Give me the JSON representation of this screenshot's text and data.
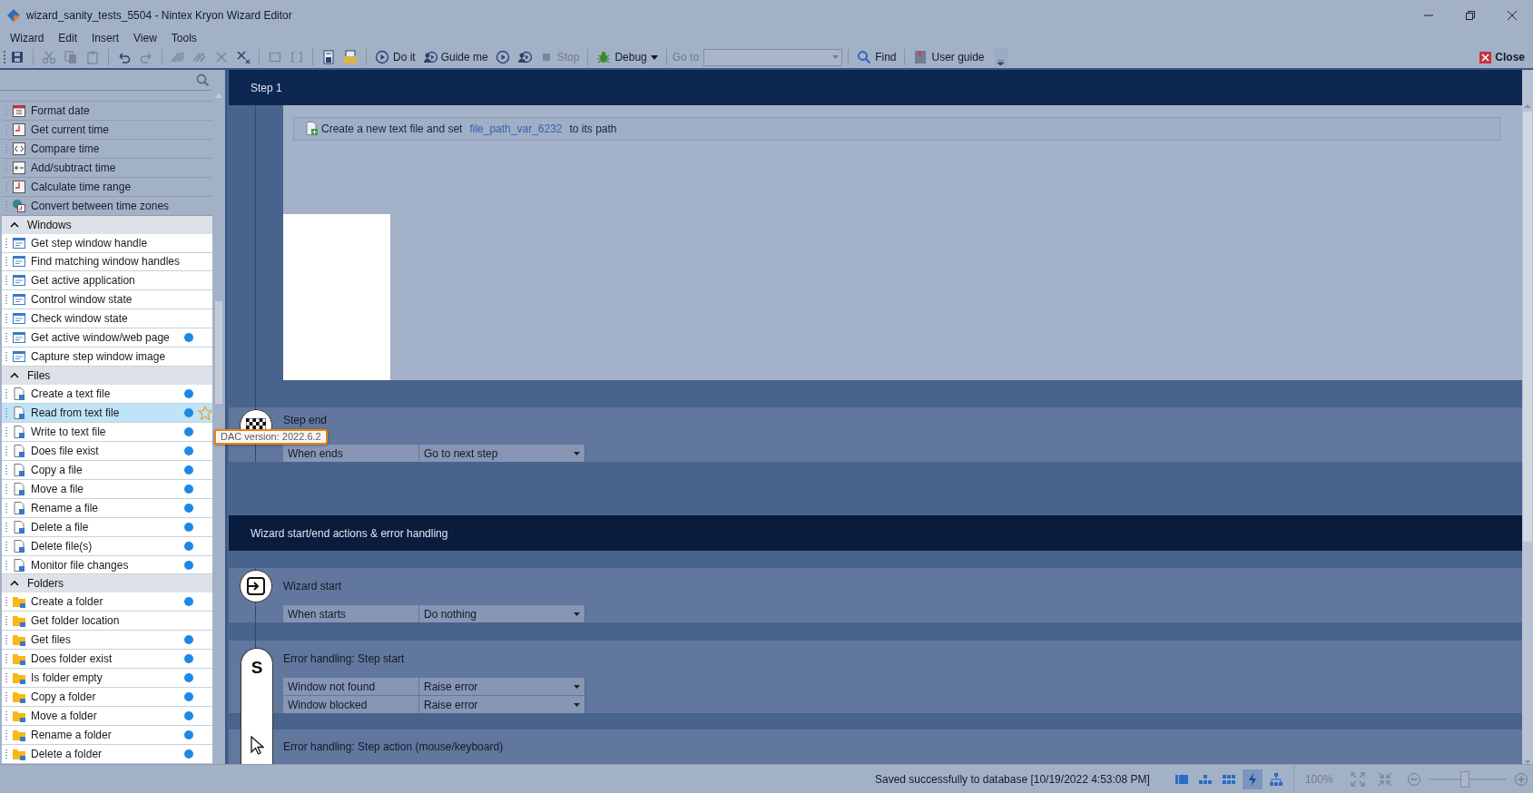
{
  "window": {
    "title": "wizard_sanity_tests_5504 - Nintex Kryon Wizard Editor"
  },
  "menu": [
    "Wizard",
    "Edit",
    "Insert",
    "View",
    "Tools"
  ],
  "toolbar": [
    {
      "kind": "save",
      "disabled": false
    },
    {
      "kind": "sep"
    },
    {
      "kind": "cut",
      "disabled": true
    },
    {
      "kind": "copy",
      "disabled": true
    },
    {
      "kind": "paste",
      "disabled": true
    },
    {
      "kind": "sep"
    },
    {
      "kind": "undo",
      "disabled": false
    },
    {
      "kind": "redo",
      "disabled": true
    },
    {
      "kind": "sep"
    },
    {
      "kind": "hatch",
      "disabled": true
    },
    {
      "kind": "hatchx",
      "disabled": true
    },
    {
      "kind": "cross",
      "disabled": true
    },
    {
      "kind": "crosssub",
      "disabled": false
    },
    {
      "kind": "sep"
    },
    {
      "kind": "square",
      "disabled": true
    },
    {
      "kind": "brackets",
      "disabled": true
    },
    {
      "kind": "sep"
    },
    {
      "kind": "docsave",
      "disabled": false
    },
    {
      "kind": "foldersave",
      "disabled": false
    },
    {
      "kind": "sep"
    },
    {
      "kind": "play",
      "label": "Do it",
      "disabled": false
    },
    {
      "kind": "guide",
      "label": "Guide me",
      "disabled": false
    },
    {
      "kind": "play",
      "disabled": false
    },
    {
      "kind": "guide",
      "disabled": false
    },
    {
      "kind": "stop",
      "label": "Stop",
      "disabled": true
    },
    {
      "kind": "sep"
    },
    {
      "kind": "debug",
      "label": "Debug",
      "disabled": false
    },
    {
      "kind": "sep"
    },
    {
      "kind": "goto",
      "label": "Go to"
    },
    {
      "kind": "sep"
    },
    {
      "kind": "find",
      "label": "Find",
      "disabled": false
    },
    {
      "kind": "sep"
    },
    {
      "kind": "book",
      "label": "User guide",
      "disabled": false
    },
    {
      "kind": "overflow"
    }
  ],
  "close_label": "Close",
  "panel": {
    "groups": [
      {
        "dimmed": true,
        "items": [
          {
            "kind": "date",
            "label": "Format date",
            "dot": false,
            "favorite": false,
            "selected": false
          },
          {
            "kind": "time",
            "label": "Get current time",
            "dot": false,
            "favorite": false,
            "selected": false
          },
          {
            "kind": "compare",
            "label": "Compare time",
            "dot": false,
            "favorite": false,
            "selected": false
          },
          {
            "kind": "plusminus",
            "label": "Add/subtract time",
            "dot": false,
            "favorite": false,
            "selected": false
          },
          {
            "kind": "time",
            "label": "Calculate time range",
            "dot": false,
            "favorite": false,
            "selected": false
          },
          {
            "kind": "globe",
            "label": "Convert between time zones",
            "dot": false,
            "favorite": false,
            "selected": false
          }
        ]
      },
      {
        "title": "Windows",
        "expanded": true,
        "dimmed": false,
        "items": [
          {
            "kind": "window",
            "label": "Get step window handle",
            "dot": false,
            "favorite": false,
            "selected": false
          },
          {
            "kind": "window",
            "label": "Find matching window handles",
            "dot": false,
            "favorite": false,
            "selected": false
          },
          {
            "kind": "window",
            "label": "Get active application",
            "dot": false,
            "favorite": false,
            "selected": false
          },
          {
            "kind": "window",
            "label": "Control window state",
            "dot": false,
            "favorite": false,
            "selected": false
          },
          {
            "kind": "window",
            "label": "Check window state",
            "dot": false,
            "favorite": false,
            "selected": false
          },
          {
            "kind": "window",
            "label": "Get active window/web page",
            "dot": true,
            "favorite": false,
            "selected": false
          },
          {
            "kind": "window",
            "label": "Capture step window image",
            "dot": false,
            "favorite": false,
            "selected": false
          }
        ]
      },
      {
        "title": "Files",
        "expanded": true,
        "dimmed": false,
        "items": [
          {
            "kind": "file",
            "label": "Create a text file",
            "dot": true,
            "favorite": false,
            "selected": false
          },
          {
            "kind": "file",
            "label": "Read from text file",
            "dot": true,
            "favorite": true,
            "selected": true
          },
          {
            "kind": "file",
            "label": "Write to text file",
            "dot": true,
            "favorite": false,
            "selected": false
          },
          {
            "kind": "file",
            "label": "Does file exist",
            "dot": true,
            "favorite": false,
            "selected": false
          },
          {
            "kind": "file",
            "label": "Copy a file",
            "dot": true,
            "favorite": false,
            "selected": false
          },
          {
            "kind": "file",
            "label": "Move a file",
            "dot": true,
            "favorite": false,
            "selected": false
          },
          {
            "kind": "file",
            "label": "Rename a file",
            "dot": true,
            "favorite": false,
            "selected": false
          },
          {
            "kind": "file",
            "label": "Delete a file",
            "dot": true,
            "favorite": false,
            "selected": false
          },
          {
            "kind": "file",
            "label": "Delete file(s)",
            "dot": true,
            "favorite": false,
            "selected": false
          },
          {
            "kind": "file",
            "label": "Monitor file changes",
            "dot": true,
            "favorite": false,
            "selected": false
          }
        ]
      },
      {
        "title": "Folders",
        "expanded": true,
        "dimmed": false,
        "items": [
          {
            "kind": "folder",
            "label": "Create a folder",
            "dot": true,
            "favorite": false,
            "selected": false
          },
          {
            "kind": "folder",
            "label": "Get folder location",
            "dot": false,
            "favorite": false,
            "selected": false
          },
          {
            "kind": "folder",
            "label": "Get files",
            "dot": true,
            "favorite": false,
            "selected": false
          },
          {
            "kind": "folder",
            "label": "Does folder exist",
            "dot": true,
            "favorite": false,
            "selected": false
          },
          {
            "kind": "folder",
            "label": "Is folder empty",
            "dot": true,
            "favorite": false,
            "selected": false
          },
          {
            "kind": "folder",
            "label": "Copy a folder",
            "dot": true,
            "favorite": false,
            "selected": false
          },
          {
            "kind": "folder",
            "label": "Move a folder",
            "dot": true,
            "favorite": false,
            "selected": false
          },
          {
            "kind": "folder",
            "label": "Rename a folder",
            "dot": true,
            "favorite": false,
            "selected": false
          },
          {
            "kind": "folder",
            "label": "Delete a folder",
            "dot": true,
            "favorite": false,
            "selected": false
          }
        ]
      }
    ]
  },
  "step": {
    "title": "Step 1",
    "action": {
      "text_before": "Create a new text file and set",
      "variable": "file_path_var_6232",
      "text_after": "to its path"
    },
    "end": {
      "title": "Step end",
      "rows": [
        {
          "label": "When ends",
          "value": "Go to next step"
        }
      ]
    }
  },
  "section_title": "Wizard start/end actions & error handling",
  "blocks": [
    {
      "kind": "start",
      "title": "Wizard start",
      "rows": [
        {
          "label": "When starts",
          "value": "Do nothing"
        }
      ]
    },
    {
      "kind": "error-start",
      "title": "Error handling: Step start",
      "badge": "S",
      "rows": [
        {
          "label": "Window not found",
          "value": "Raise error"
        },
        {
          "label": "Window blocked",
          "value": "Raise error"
        }
      ]
    },
    {
      "kind": "error-action",
      "title": "Error handling: Step action (mouse/keyboard)"
    }
  ],
  "tooltip": "DAC version: 2022.6.2",
  "status": {
    "message": "Saved successfully to database [10/19/2022 4:53:08 PM]",
    "views": [
      {
        "selected": false
      },
      {
        "selected": false
      },
      {
        "selected": false
      },
      {
        "selected": true
      },
      {
        "selected": false
      }
    ],
    "zoom": "100%",
    "zoom_slider": {
      "level": 0.47
    }
  }
}
